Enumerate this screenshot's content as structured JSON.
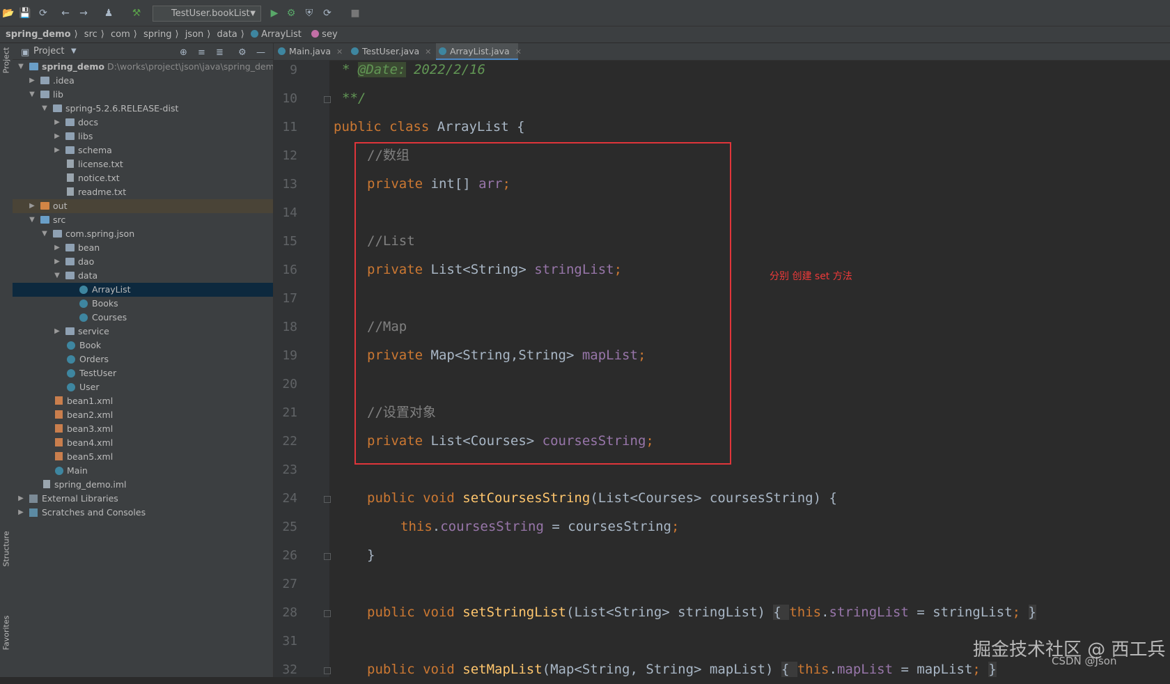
{
  "toolbar": {
    "run_config": "TestUser.bookList"
  },
  "breadcrumb": [
    "spring_demo",
    "src",
    "com",
    "spring",
    "json",
    "data",
    "ArrayList",
    "sey"
  ],
  "side_stripe": {
    "project": "Project",
    "structure": "Structure",
    "favorites": "Favorites"
  },
  "project_panel": {
    "title": "Project",
    "tree": [
      {
        "label": "spring_demo",
        "hint": "D:\\works\\project\\json\\java\\spring_demo",
        "icon": "module-folder-icon"
      },
      {
        "label": ".idea",
        "icon": "folder-icon"
      },
      {
        "label": "lib",
        "icon": "folder-icon"
      },
      {
        "label": "spring-5.2.6.RELEASE-dist",
        "icon": "folder-icon"
      },
      {
        "label": "docs",
        "icon": "folder-icon"
      },
      {
        "label": "libs",
        "icon": "folder-icon"
      },
      {
        "label": "schema",
        "icon": "folder-icon"
      },
      {
        "label": "license.txt",
        "icon": "text-file-icon"
      },
      {
        "label": "notice.txt",
        "icon": "text-file-icon"
      },
      {
        "label": "readme.txt",
        "icon": "text-file-icon"
      },
      {
        "label": "out",
        "icon": "folder-icon"
      },
      {
        "label": "src",
        "icon": "folder-icon"
      },
      {
        "label": "com.spring.json",
        "icon": "package-icon"
      },
      {
        "label": "bean",
        "icon": "package-icon"
      },
      {
        "label": "dao",
        "icon": "package-icon"
      },
      {
        "label": "data",
        "icon": "package-icon"
      },
      {
        "label": "ArrayList",
        "icon": "class-icon"
      },
      {
        "label": "Books",
        "icon": "class-icon"
      },
      {
        "label": "Courses",
        "icon": "class-icon"
      },
      {
        "label": "service",
        "icon": "package-icon"
      },
      {
        "label": "Book",
        "icon": "class-icon"
      },
      {
        "label": "Orders",
        "icon": "class-icon"
      },
      {
        "label": "TestUser",
        "icon": "class-icon"
      },
      {
        "label": "User",
        "icon": "class-icon"
      },
      {
        "label": "bean1.xml",
        "icon": "xml-file-icon"
      },
      {
        "label": "bean2.xml",
        "icon": "xml-file-icon"
      },
      {
        "label": "bean3.xml",
        "icon": "xml-file-icon"
      },
      {
        "label": "bean4.xml",
        "icon": "xml-file-icon"
      },
      {
        "label": "bean5.xml",
        "icon": "xml-file-icon"
      },
      {
        "label": "Main",
        "icon": "class-icon"
      },
      {
        "label": "spring_demo.iml",
        "icon": "iml-file-icon"
      },
      {
        "label": "External Libraries",
        "icon": "library-icon"
      },
      {
        "label": "Scratches and Consoles",
        "icon": "scratches-icon"
      }
    ]
  },
  "tabs": [
    {
      "label": "Main.java",
      "active": false
    },
    {
      "label": "TestUser.java",
      "active": false
    },
    {
      "label": "ArrayList.java",
      "active": true
    }
  ],
  "line_numbers": [
    "9",
    "10",
    "11",
    "12",
    "13",
    "14",
    "15",
    "16",
    "17",
    "18",
    "19",
    "20",
    "21",
    "22",
    "23",
    "24",
    "25",
    "26",
    "27",
    "28",
    "31",
    "32"
  ],
  "code": {
    "l9_star": "* ",
    "l9_tag": "@Date:",
    "l9_date": " 2022/2/16",
    "l10": "**/",
    "l11_kw": "public class ",
    "l11_name": "ArrayList {",
    "l12": "//数组",
    "l13_kw": "private ",
    "l13_type": "int[] ",
    "l13_fld": "arr",
    "l13_end": ";",
    "l15": "//List",
    "l16_kw": "private ",
    "l16_type": "List<String> ",
    "l16_fld": "stringList",
    "l16_end": ";",
    "l18": "//Map",
    "l19_kw": "private ",
    "l19_type": "Map<String,String> ",
    "l19_fld": "mapList",
    "l19_end": ";",
    "l21": "//设置对象",
    "l22_kw": "private ",
    "l22_type": "List<Courses> ",
    "l22_fld": "coursesString",
    "l22_end": ";",
    "l24_kw": "public void ",
    "l24_fn": "setCoursesString",
    "l24_rest": "(List<Courses> coursesString) {",
    "l25_this": "this",
    "l25_dot": ".",
    "l25_fld": "coursesString",
    "l25_rest": " = coursesString",
    "l25_end": ";",
    "l26": "}",
    "l28_kw": "public void ",
    "l28_fn": "setStringList",
    "l28_rest": "(List<String> stringList) ",
    "l28_open": "{ ",
    "l28_this": "this",
    "l28_dot": ".",
    "l28_fld": "stringList",
    "l28_assign": " = stringList",
    "l28_semi": "; ",
    "l28_close": "}",
    "l32_kw": "public void ",
    "l32_fn": "setMapList",
    "l32_rest": "(Map<String, String> mapList) ",
    "l32_open": "{ ",
    "l32_this": "this",
    "l32_dot": ".",
    "l32_fld": "mapList",
    "l32_assign": " = mapList",
    "l32_semi": "; ",
    "l32_close": "}"
  },
  "annotation": "分别 创建 set 方法",
  "watermark": {
    "main": "掘金技术社区 @ 西工兵",
    "sub": "CSDN @Json"
  },
  "colors": {
    "highlight_box": "#e0353a",
    "keyword": "#cc7832",
    "field": "#9876aa",
    "method": "#ffc66d",
    "comment": "#808080"
  }
}
